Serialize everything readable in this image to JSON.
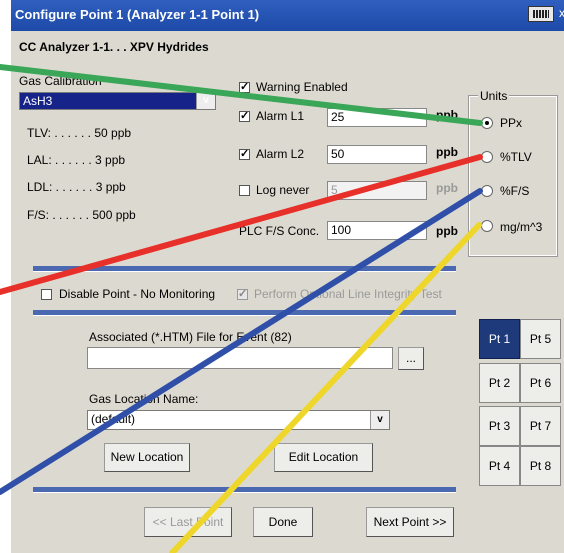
{
  "window": {
    "title": "Configure Point 1 (Analyzer 1-1 Point 1)"
  },
  "header": {
    "text": "CC Analyzer 1-1. . .  XPV Hydrides"
  },
  "gas_calibration": {
    "label": "Gas Calibration",
    "value": "AsH3",
    "tlv": "TLV: . . . . . . 50 ppb",
    "lal": "LAL: . . . . . . 3 ppb",
    "ldl": "LDL: . . . . . . 3 ppb",
    "fs": "F/S: . . . . . . 500 ppb"
  },
  "alarms": {
    "warning_enabled": {
      "label": "Warning Enabled",
      "checked": true
    },
    "alarm_l1": {
      "label": "Alarm L1",
      "value": "25",
      "unit": "ppb",
      "checked": true
    },
    "alarm_l2": {
      "label": "Alarm L2",
      "value": "50",
      "unit": "ppb",
      "checked": true
    },
    "log_never": {
      "label": "Log never",
      "value": "5",
      "unit": "ppb",
      "checked": false
    },
    "plc_fs": {
      "label": "PLC F/S Conc.",
      "value": "100",
      "unit": "ppb"
    }
  },
  "units": {
    "label": "Units",
    "options": [
      "PPx",
      "%TLV",
      "%F/S",
      "mg/m^3"
    ],
    "selected": "PPx"
  },
  "monitoring": {
    "disable_label": "Disable Point  - No Monitoring",
    "integrity_label": "Perform Optional Line Integrity Test"
  },
  "associated_file": {
    "label": "Associated (*.HTM) File for Event (82)",
    "value": "",
    "browse_label": "..."
  },
  "gas_location": {
    "label": "Gas Location Name:",
    "value": "(default)",
    "new_label": "New Location",
    "edit_label": "Edit Location"
  },
  "navigation": {
    "last_label": "<< Last Point",
    "done_label": "Done",
    "next_label": "Next Point >>"
  },
  "points": [
    "Pt 1",
    "Pt 5",
    "Pt 2",
    "Pt 6",
    "Pt 3",
    "Pt 7",
    "Pt 4",
    "Pt 8"
  ],
  "colors": {
    "green": "#3aa657",
    "red": "#e8302a",
    "blue": "#2f4fa8",
    "yellow": "#efd62a",
    "titlebar": "#2354b5"
  }
}
